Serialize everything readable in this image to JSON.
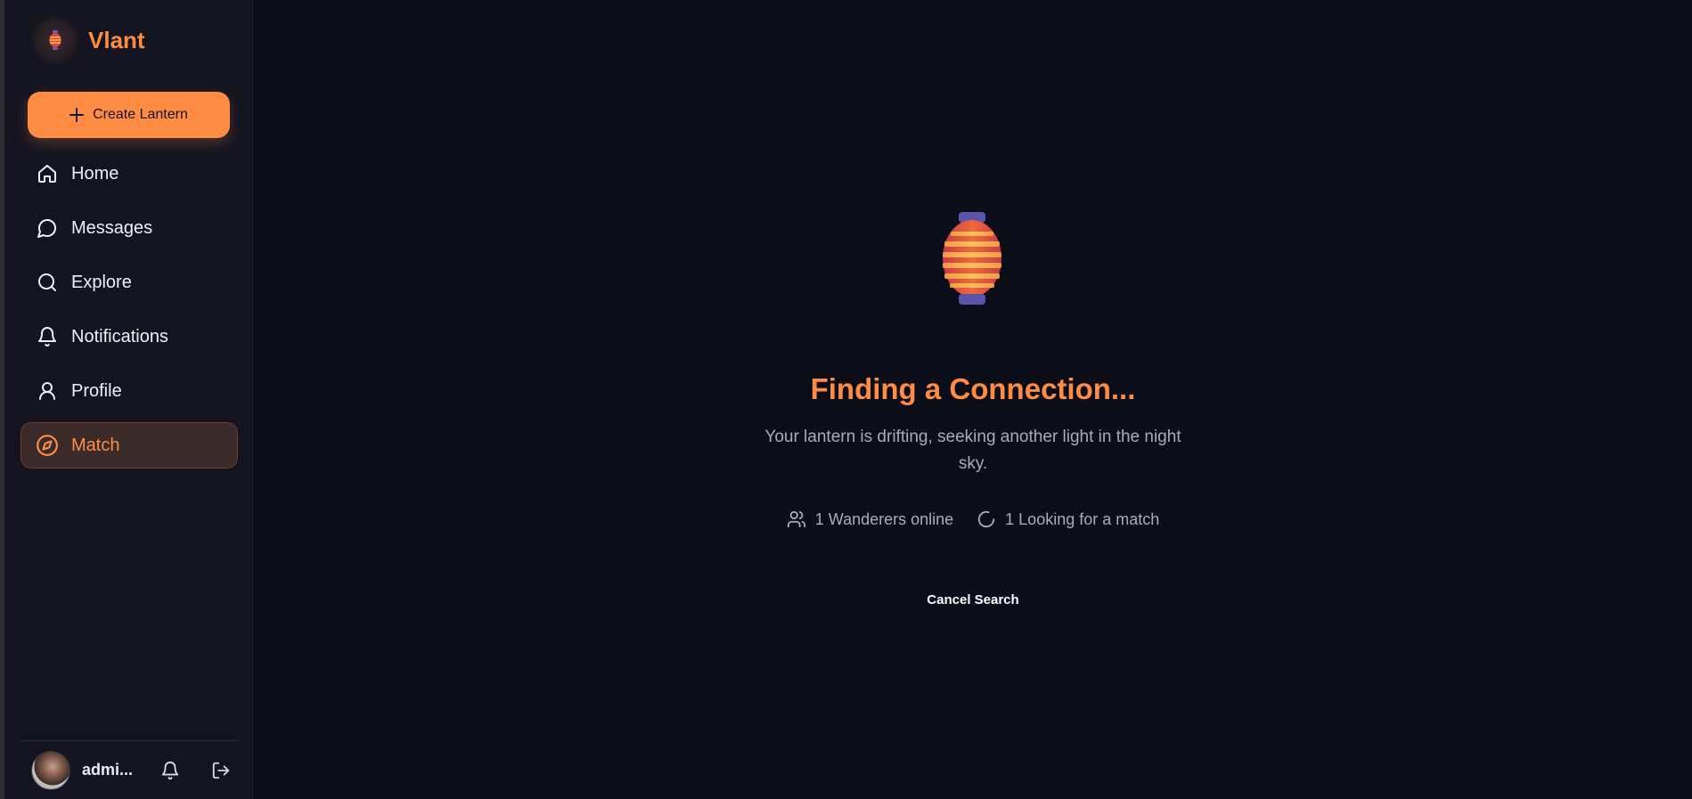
{
  "brand": {
    "name": "Vlant"
  },
  "sidebar": {
    "create_label": "Create Lantern",
    "items": [
      {
        "label": "Home",
        "icon": "home-icon"
      },
      {
        "label": "Messages",
        "icon": "message-icon"
      },
      {
        "label": "Explore",
        "icon": "search-icon"
      },
      {
        "label": "Notifications",
        "icon": "bell-icon"
      },
      {
        "label": "Profile",
        "icon": "user-icon"
      },
      {
        "label": "Match",
        "icon": "compass-icon",
        "active": true
      }
    ]
  },
  "user": {
    "name": "admi..."
  },
  "main": {
    "title": "Finding a Connection...",
    "subtitle": "Your lantern is drifting, seeking another light in the night sky.",
    "stats": {
      "online": "1 Wanderers online",
      "looking": "1 Looking for a match"
    },
    "cancel_label": "Cancel Search"
  },
  "colors": {
    "accent": "#ff8c42",
    "background": "#0b0d19",
    "sidebar": "#13141f",
    "active_bg": "#3a2a29",
    "muted_text": "#a7acbb"
  }
}
